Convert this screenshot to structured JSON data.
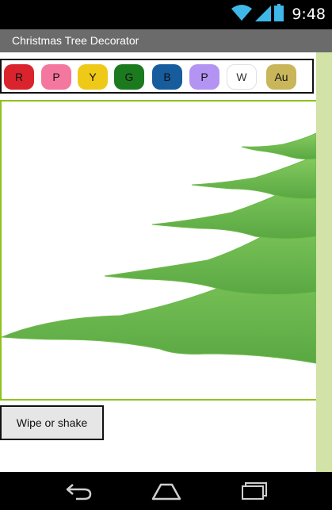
{
  "status_bar": {
    "time": "9:48",
    "icons": [
      "wifi-icon",
      "signal-icon",
      "battery-icon"
    ]
  },
  "app": {
    "title": "Christmas Tree Decorator"
  },
  "palette": {
    "swatches": [
      {
        "label": "R",
        "color": "#d9232d",
        "text_color": "#111111"
      },
      {
        "label": "P",
        "color": "#f4779f",
        "text_color": "#111111"
      },
      {
        "label": "Y",
        "color": "#efc918",
        "text_color": "#111111"
      },
      {
        "label": "G",
        "color": "#1c7a1e",
        "text_color": "#111111"
      },
      {
        "label": "B",
        "color": "#175c9c",
        "text_color": "#111111"
      },
      {
        "label": "P",
        "color": "#b394f2",
        "text_color": "#111111"
      },
      {
        "label": "W",
        "color": "#ffffff",
        "text_color": "#333333"
      },
      {
        "label": "Au",
        "color": "#c9b55a",
        "text_color": "#111111"
      }
    ]
  },
  "colors": {
    "canvas_border": "#8fc21d",
    "tree_light": "#7fc45c",
    "tree_dark": "#57a43f",
    "side_strip": "#d3e2a6"
  },
  "actions": {
    "wipe_label": "Wipe or shake"
  },
  "nav": {
    "icons": [
      "back-icon",
      "home-icon",
      "recents-icon"
    ]
  }
}
